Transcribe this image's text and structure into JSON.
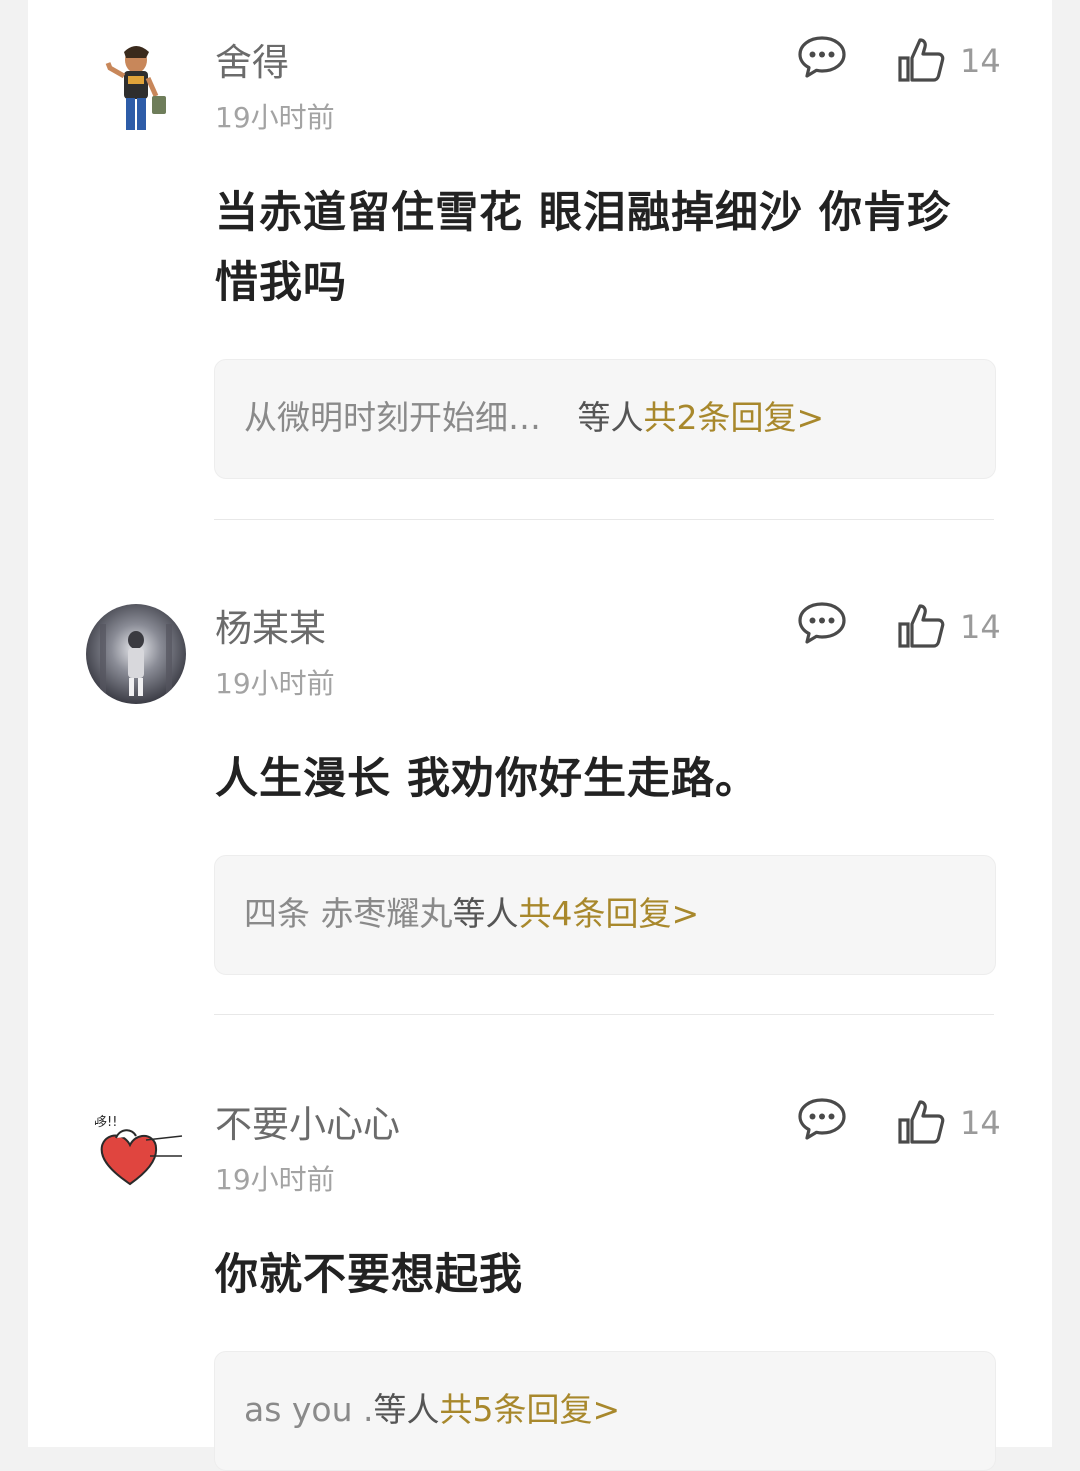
{
  "comments": [
    {
      "username": "舍得",
      "time": "19小时前",
      "likes": "14",
      "text": "当赤道留住雪花 眼泪融掉细沙 你肯珍惜我吗",
      "reply_names": "从微明时刻开始细…",
      "reply_others": "等人",
      "reply_total": "共2条回复>"
    },
    {
      "username": "杨某某",
      "time": "19小时前",
      "likes": "14",
      "text": "人生漫长 我劝你好生走路。",
      "reply_names": "四条 赤枣耀丸",
      "reply_others": "等人",
      "reply_total": "共4条回复>"
    },
    {
      "username": "不要小心心",
      "time": "19小时前",
      "likes": "14",
      "text": "你就不要想起我",
      "reply_names": "as you .",
      "reply_others": "等人",
      "reply_total": "共5条回复>"
    }
  ],
  "icons": {
    "reply": "chat-bubble-icon",
    "like": "thumbs-up-icon"
  },
  "colors": {
    "accent": "#a8882c",
    "username": "#6b6b6b",
    "timestamp": "#a3a3a3",
    "text": "#222222"
  }
}
